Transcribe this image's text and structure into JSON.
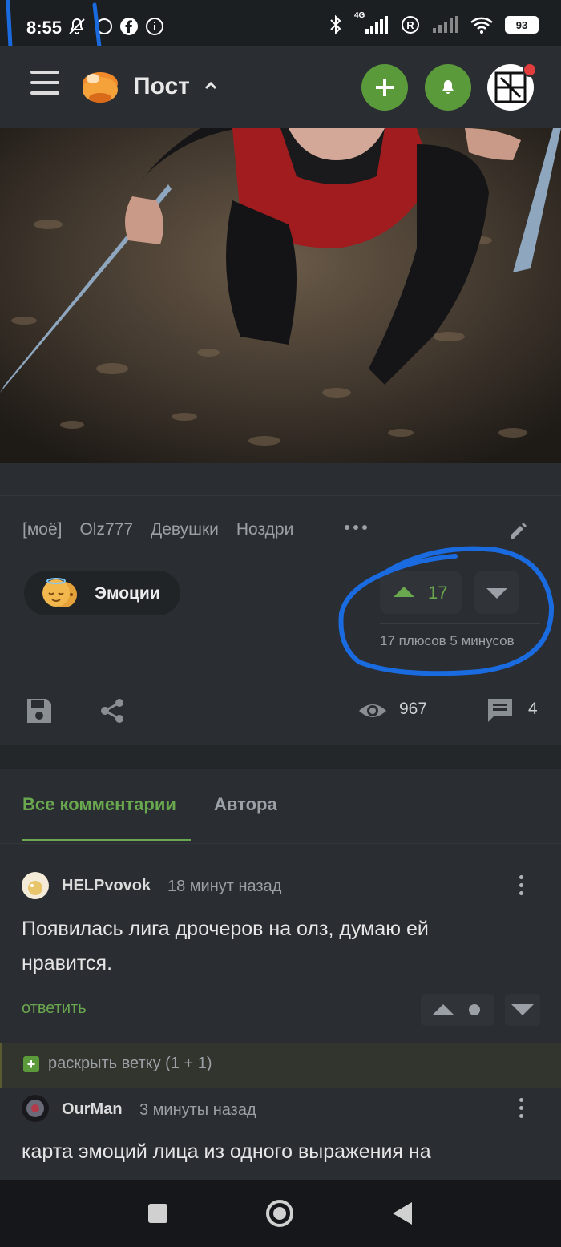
{
  "status_bar": {
    "time": "8:55",
    "network": "4G",
    "battery": "93",
    "icons": [
      "bell-off-icon",
      "whatsapp-icon",
      "facebook-icon",
      "info-icon",
      "bluetooth-icon",
      "signal-icon",
      "roaming-icon",
      "signal-icon",
      "wifi-icon",
      "battery-icon"
    ]
  },
  "app_bar": {
    "title": "Пост",
    "menu_icon": "hamburger-icon",
    "add_icon": "plus-icon",
    "notifications_icon": "bell-icon",
    "accent_color": "#5a9a3b",
    "badge_color": "#e23d3d"
  },
  "post": {
    "tags": [
      "[моё]",
      "Olz777",
      "Девушки",
      "Ноздри"
    ],
    "emotions_label": "Эмоции",
    "rating": "17",
    "rating_stats": "17 плюсов 5 минусов",
    "views": "967",
    "comments_count": "4"
  },
  "comments_tabs": {
    "all": "Все комментарии",
    "author": "Автора"
  },
  "comments": [
    {
      "user": "HELPvovok",
      "time": "18 минут назад",
      "text": "Появилась лига дрочеров на олз, думаю ей нравится.",
      "reply": "ответить"
    },
    {
      "user": "OurMan",
      "time": "3 минуты назад",
      "text": "карта эмоций лица из одного выражения на"
    }
  ],
  "expand_thread": "раскрыть ветку (1 + 1)"
}
